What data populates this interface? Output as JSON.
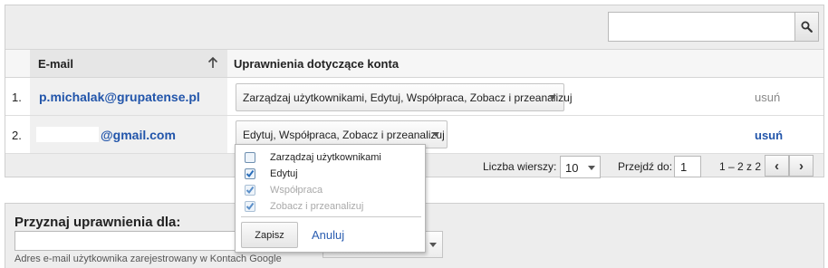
{
  "search": {
    "value": "",
    "icon": "search-icon"
  },
  "table": {
    "headers": {
      "email": "E-mail",
      "permissions": "Uprawnienia dotyczące konta"
    },
    "rows": [
      {
        "num": "1.",
        "email": "p.michalak@grupatense.pl",
        "permissions": "Zarządzaj użytkownikami, Edytuj, Współpraca, Zobacz i przeanalizuj",
        "remove": "usuń"
      },
      {
        "num": "2.",
        "email": "@gmail.com",
        "permissions": "Edytuj, Współpraca, Zobacz i przeanalizuj",
        "remove": "usuń"
      }
    ]
  },
  "pagination": {
    "rows_label": "Liczba wierszy:",
    "rows_value": "10",
    "goto_label": "Przejdź do:",
    "goto_value": "1",
    "range": "1 – 2 z 2",
    "prev": "‹",
    "next": "›"
  },
  "popup": {
    "options": [
      {
        "label": "Zarządzaj użytkownikami",
        "checked": false,
        "disabled": false
      },
      {
        "label": "Edytuj",
        "checked": true,
        "disabled": false
      },
      {
        "label": "Współpraca",
        "checked": true,
        "disabled": true
      },
      {
        "label": "Zobacz i przeanalizuj",
        "checked": true,
        "disabled": true
      }
    ],
    "save": "Zapisz",
    "cancel": "Anuluj"
  },
  "assign": {
    "title": "Przyznaj uprawnienia dla:",
    "input_value": "",
    "help": "Adres e-mail użytkownika zarejestrowany w Kontach Google"
  },
  "colors": {
    "link": "#2255aa",
    "panel_bg": "#ededed",
    "check": "#2a6ebb"
  }
}
